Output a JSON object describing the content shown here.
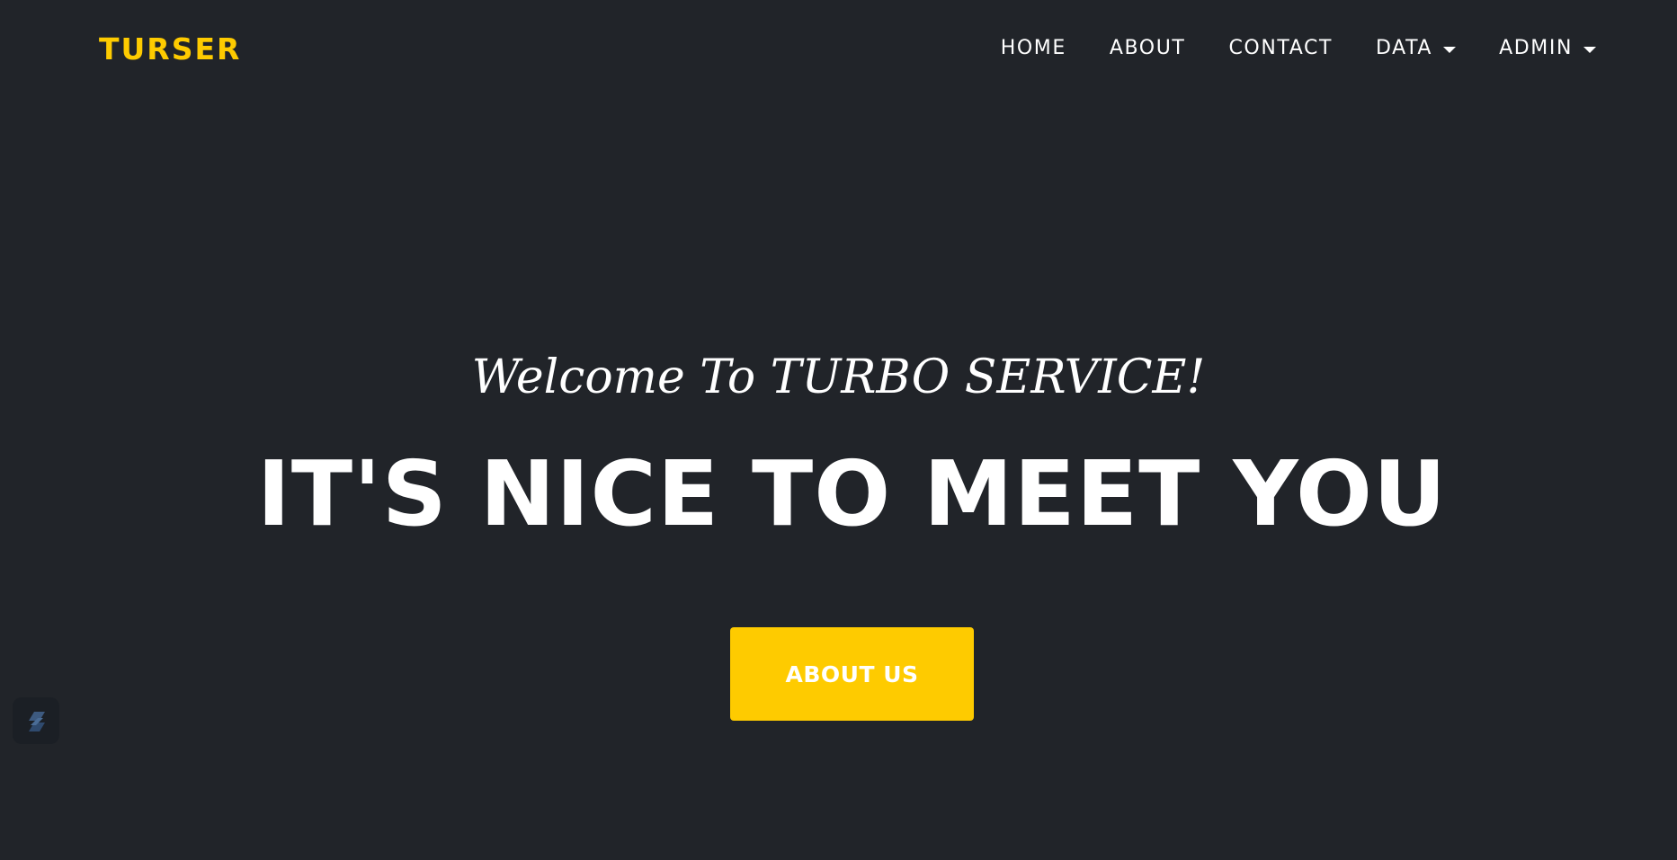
{
  "brand": {
    "name": "TURSER",
    "color": "#fecb00"
  },
  "nav": {
    "items": [
      {
        "label": "HOME",
        "has_dropdown": false
      },
      {
        "label": "ABOUT",
        "has_dropdown": false
      },
      {
        "label": "CONTACT",
        "has_dropdown": false
      },
      {
        "label": "DATA",
        "has_dropdown": true
      },
      {
        "label": "ADMIN",
        "has_dropdown": true
      }
    ]
  },
  "hero": {
    "subheading": "Welcome To TURBO SERVICE!",
    "heading": "IT'S NICE TO MEET YOU",
    "cta_label": "ABOUT US"
  },
  "colors": {
    "background": "#212429",
    "accent": "#fecb00",
    "text": "#ffffff"
  },
  "widget": {
    "icon": "stacked-bars-icon"
  }
}
